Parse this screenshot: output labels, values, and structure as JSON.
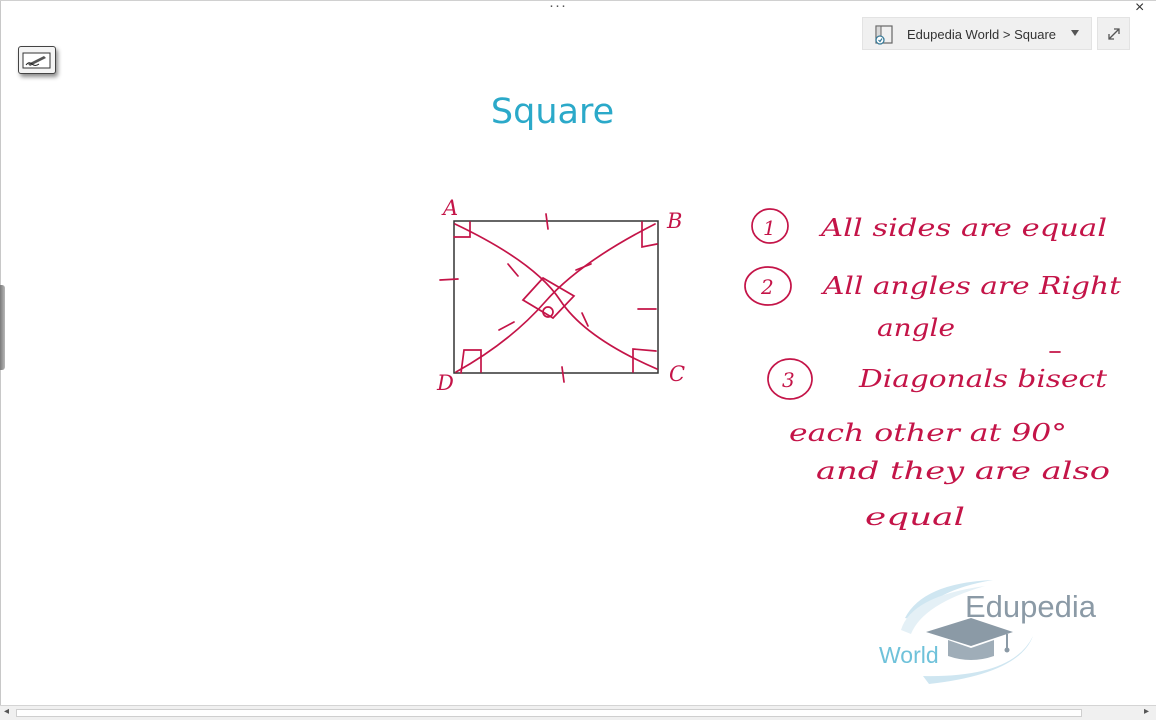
{
  "window": {
    "more_dots": "···",
    "close_glyph": "×"
  },
  "nav": {
    "breadcrumb": "Edupedia World > Square"
  },
  "page": {
    "title": "Square"
  },
  "figure": {
    "vertices": [
      "A",
      "B",
      "C",
      "D"
    ]
  },
  "notes": {
    "items": [
      {
        "number": "1",
        "lines": [
          "All sides are equal"
        ]
      },
      {
        "number": "2",
        "lines": [
          "All angles are Right",
          "angle"
        ]
      },
      {
        "number": "3",
        "lines": [
          "Diagonals bisect",
          "each other at 90°",
          "and they are also",
          "equal"
        ]
      }
    ]
  },
  "logo": {
    "brand": "Edupedia",
    "sub": "World"
  },
  "colors": {
    "ink": "#c41448",
    "title": "#2ba9c9",
    "logo_gray": "#8b9aa6",
    "logo_blue": "#6fc2da"
  },
  "icons": {
    "toolbar": "pen-annotation-icon",
    "nav": "notebook-section-icon",
    "caret": "caret-down-icon",
    "expand": "expand-diagonal-icon"
  }
}
